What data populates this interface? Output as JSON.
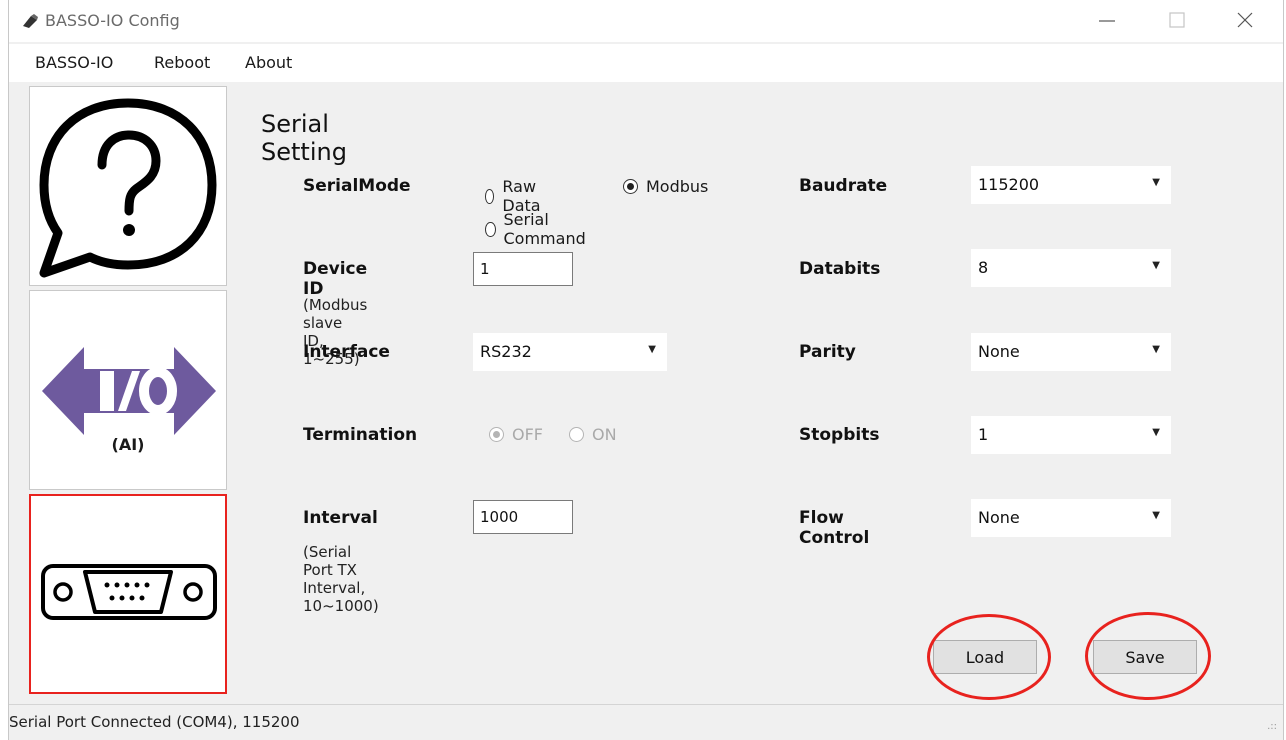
{
  "window": {
    "title": "BASSO-IO Config"
  },
  "menu": {
    "items": [
      "BASSO-IO",
      "Reboot",
      "About"
    ]
  },
  "sidebar": {
    "buttons": [
      {
        "icon": "help-speech-bubble-icon"
      },
      {
        "icon": "io-arrows-icon",
        "label": "(AI)"
      },
      {
        "icon": "serial-port-connector-icon",
        "selected": true
      }
    ]
  },
  "main": {
    "title": "Serial Setting",
    "serial_mode": {
      "label": "SerialMode",
      "options": [
        "Raw Data",
        "Modbus",
        "Serial Command"
      ],
      "selected": "Modbus"
    },
    "device_id": {
      "label": "Device ID",
      "value": "1",
      "hint": "(Modbus slave ID, 1~255)"
    },
    "interface": {
      "label": "Interface",
      "value": "RS232"
    },
    "termination": {
      "label": "Termination",
      "options": [
        "OFF",
        "ON"
      ],
      "selected": "OFF",
      "disabled": true
    },
    "interval": {
      "label": "Interval",
      "value": "1000",
      "hint": "(Serial Port TX Interval, 10~1000)"
    },
    "baudrate": {
      "label": "Baudrate",
      "value": "115200"
    },
    "databits": {
      "label": "Databits",
      "value": "8"
    },
    "parity": {
      "label": "Parity",
      "value": "None"
    },
    "stopbits": {
      "label": "Stopbits",
      "value": "1"
    },
    "flow_control": {
      "label": "Flow Control",
      "value": "None"
    },
    "load_label": "Load",
    "save_label": "Save"
  },
  "status": {
    "text": "Serial Port Connected (COM4), 115200"
  },
  "colors": {
    "highlight": "#e8221e",
    "io_icon": "#6e5a9e",
    "window_bg": "#f0f0f0"
  }
}
